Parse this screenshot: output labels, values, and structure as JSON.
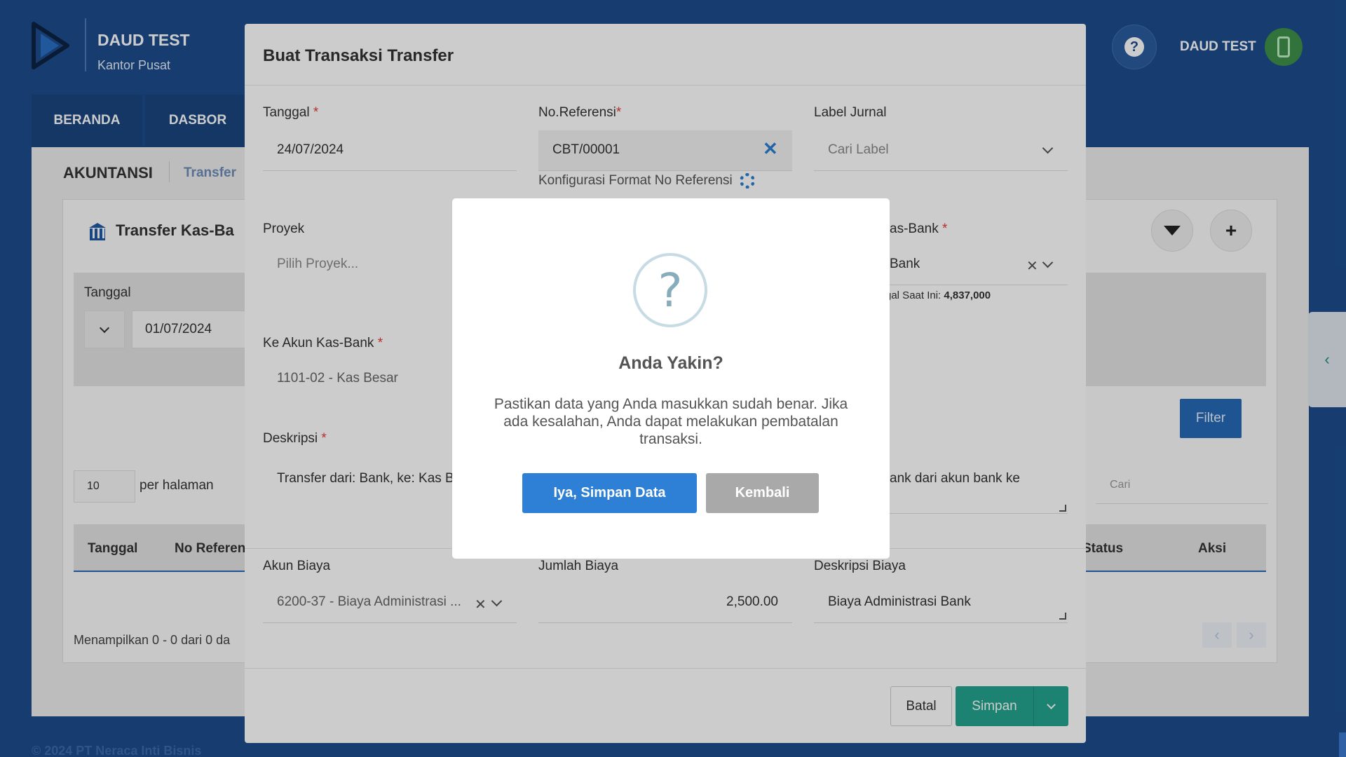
{
  "app": {
    "company": "DAUD TEST",
    "branch": "Kantor Pusat",
    "user_name": "DAUD TEST",
    "help_glyph": "?",
    "footer": "© 2024 PT Neraca Inti Bisnis"
  },
  "nav": {
    "tabs": [
      {
        "label": "BERANDA"
      },
      {
        "label": "DASBOR"
      }
    ]
  },
  "background": {
    "breadcrumb": {
      "main": "AKUNTANSI",
      "sub": "Transfer"
    },
    "card_title": "Transfer Kas-Ba",
    "date_label": "Tanggal",
    "date_value": "01/07/2024",
    "filter_button": "Filter",
    "per_page_value": "10",
    "per_page_label": "per halaman",
    "search_placeholder": "Cari",
    "table_headers": [
      "Tanggal",
      "No Referen",
      "Status",
      "Aksi"
    ],
    "showing": "Menampilkan 0 - 0 dari 0 da",
    "pager_prev": "‹",
    "pager_next": "›",
    "side_tab_arrow": "‹",
    "plus_glyph": "+"
  },
  "modal": {
    "title": "Buat Transaksi Transfer",
    "fields": {
      "tanggal": {
        "label": "Tanggal",
        "required": "*",
        "value": "24/07/2024"
      },
      "no_referensi": {
        "label": "No.Referensi",
        "required": "*",
        "value": "CBT/00001",
        "config_link": "Konfigurasi Format No Referensi"
      },
      "label_jurnal": {
        "label": "Label Jurnal",
        "placeholder": "Cari Label"
      },
      "proyek": {
        "label": "Proyek",
        "placeholder": "Pilih Proyek..."
      },
      "dari_akun": {
        "label_partial": "as-Bank",
        "required": "*",
        "value_partial": "Bank",
        "saldo_label": "gal Saat Ini: ",
        "saldo_value": "4,837,000"
      },
      "ke_akun": {
        "label": "Ke Akun Kas-Bank",
        "required": "*",
        "value": "1101-02 - Kas Besar"
      },
      "deskripsi": {
        "label": "Deskripsi",
        "required": "*",
        "value": "Transfer dari: Bank, ke: Kas B",
        "value_right_partial": "ank dari akun bank ke"
      },
      "akun_biaya": {
        "label": "Akun Biaya",
        "value": "6200-37 - Biaya Administrasi ..."
      },
      "jumlah_biaya": {
        "label": "Jumlah Biaya",
        "value": "2,500.00"
      },
      "deskripsi_biaya": {
        "label": "Deskripsi Biaya",
        "value": "Biaya Administrasi Bank"
      }
    },
    "buttons": {
      "batal": "Batal",
      "simpan": "Simpan"
    }
  },
  "confirm_dialog": {
    "icon_glyph": "?",
    "title": "Anda Yakin?",
    "text": "Pastikan data yang Anda masukkan sudah benar. Jika ada kesalahan, Anda dapat melakukan pembatalan transaksi.",
    "confirm_button": "Iya, Simpan Data",
    "cancel_button": "Kembali"
  },
  "colors": {
    "header_bg": "#1d4d8c",
    "primary": "#2e7fd6",
    "success": "#24a38f",
    "required": "#e53935"
  }
}
